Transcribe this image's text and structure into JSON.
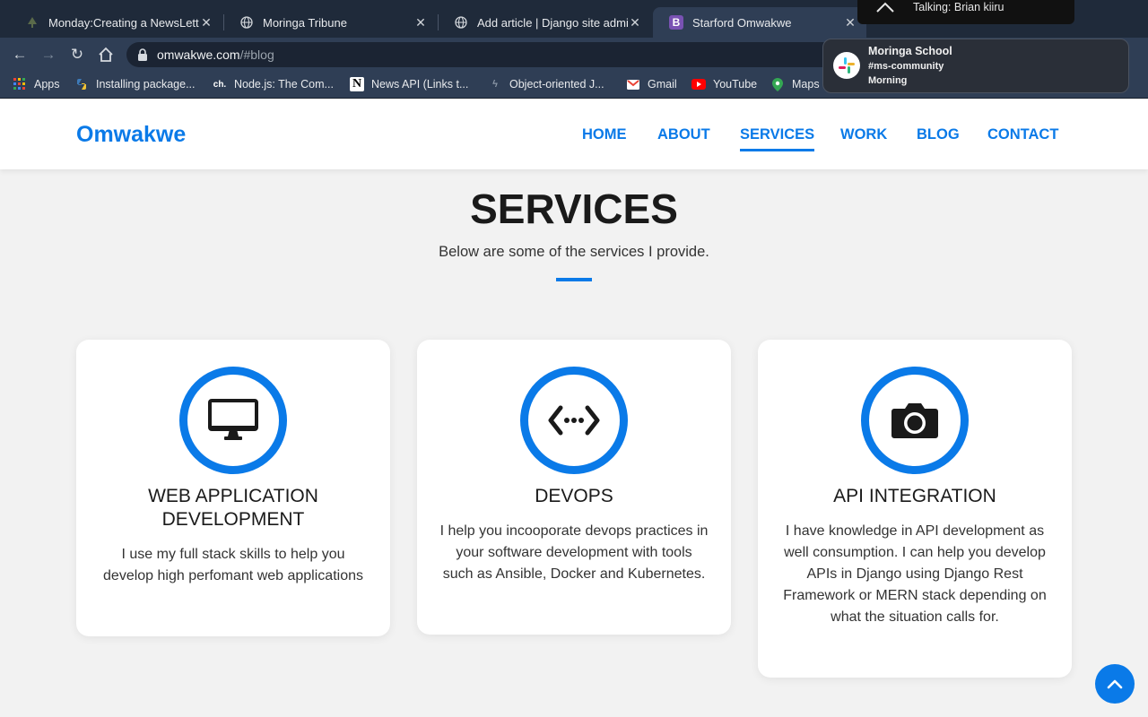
{
  "browser": {
    "tabs": [
      {
        "title": "Monday:Creating a NewsLetter"
      },
      {
        "title": "Moringa Tribune"
      },
      {
        "title": "Add article | Django site admin"
      },
      {
        "title": "Starford Omwakwe",
        "active": true
      }
    ],
    "address": {
      "host": "omwakwe.com",
      "path": "/#blog"
    },
    "bookmarks": [
      {
        "label": "Apps"
      },
      {
        "label": "Installing package..."
      },
      {
        "label": "Node.js: The Com..."
      },
      {
        "label": "News API (Links t..."
      },
      {
        "label": "Object-oriented J..."
      },
      {
        "label": "Gmail"
      },
      {
        "label": "YouTube"
      },
      {
        "label": "Maps"
      }
    ]
  },
  "notifications": {
    "talking": "Talking: Brian kiiru",
    "toast": {
      "app": "Moringa School",
      "channel": "#ms-community",
      "message": "Morning"
    }
  },
  "site": {
    "brand": "Omwakwe",
    "nav": [
      {
        "label": "HOME"
      },
      {
        "label": "ABOUT"
      },
      {
        "label": "SERVICES",
        "active": true
      },
      {
        "label": "WORK"
      },
      {
        "label": "BLOG"
      },
      {
        "label": "CONTACT"
      }
    ]
  },
  "section": {
    "title": "SERVICES",
    "subtitle": "Below are some of the services I provide."
  },
  "services": [
    {
      "icon": "desktop-icon",
      "title_line1": "WEB APPLICATION",
      "title_line2": "DEVELOPMENT",
      "lines": [
        "I use my full stack skills to help you",
        "develop high perfomant web applications"
      ]
    },
    {
      "icon": "code-icon",
      "title_line1": "DEVOPS",
      "lines": [
        "I help you incooporate devops practices in",
        "your software development with tools",
        "such as Ansible, Docker and Kubernetes."
      ]
    },
    {
      "icon": "camera-icon",
      "title_line1": "API INTEGRATION",
      "lines": [
        "I have knowledge in API development as",
        "well consumption. I can help you develop",
        "APIs in Django using Django Rest",
        "Framework or MERN stack depending on",
        "what the situation calls for."
      ]
    }
  ],
  "colors": {
    "accent": "#0a7ae8",
    "chrome_dark": "#1f2a3a",
    "chrome": "#2f3e55"
  }
}
